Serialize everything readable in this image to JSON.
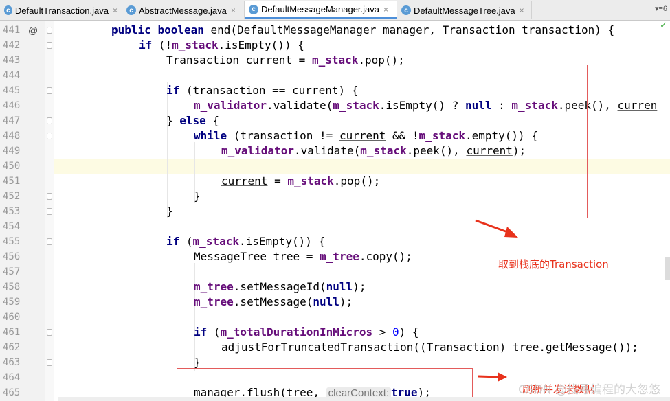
{
  "tabs": [
    {
      "label": "DefaultTransaction.java",
      "icon": "java-class-icon",
      "active": false
    },
    {
      "label": "AbstractMessage.java",
      "icon": "java-class-icon",
      "active": false
    },
    {
      "label": "DefaultMessageManager.java",
      "icon": "java-class-icon",
      "active": true
    },
    {
      "label": "DefaultMessageTree.java",
      "icon": "java-class-icon",
      "active": false
    }
  ],
  "tab_icon_letter": "c",
  "tab_close": "×",
  "tab_menu": "▾≡6",
  "gutter_marker_441": "@",
  "lines": [
    {
      "n": "441"
    },
    {
      "n": "442"
    },
    {
      "n": "443"
    },
    {
      "n": "444"
    },
    {
      "n": "445"
    },
    {
      "n": "446"
    },
    {
      "n": "447"
    },
    {
      "n": "448"
    },
    {
      "n": "449"
    },
    {
      "n": "450"
    },
    {
      "n": "451"
    },
    {
      "n": "452"
    },
    {
      "n": "453"
    },
    {
      "n": "454"
    },
    {
      "n": "455"
    },
    {
      "n": "456"
    },
    {
      "n": "457"
    },
    {
      "n": "458"
    },
    {
      "n": "459"
    },
    {
      "n": "460"
    },
    {
      "n": "461"
    },
    {
      "n": "462"
    },
    {
      "n": "463"
    },
    {
      "n": "464"
    },
    {
      "n": "465"
    }
  ],
  "code": {
    "l441": {
      "kw1": "public",
      "kw2": "boolean",
      "rest": " end(DefaultMessageManager manager, Transaction transaction) {"
    },
    "l442": {
      "kw": "if",
      "p1": " (!",
      "fld": "m_stack",
      "p2": ".isEmpty()) {"
    },
    "l443": {
      "p1": "Transaction ",
      "ul": "current",
      "p2": " = ",
      "fld": "m_stack",
      "p3": ".pop();"
    },
    "l445": {
      "kw": "if",
      "p1": " (transaction == ",
      "ul": "current",
      "p2": ") {"
    },
    "l446": {
      "fld1": "m_validator",
      "p1": ".validate(",
      "fld2": "m_stack",
      "p2": ".isEmpty() ? ",
      "kw": "null",
      "p3": " : ",
      "fld3": "m_stack",
      "p4": ".peek(), ",
      "ul": "curren"
    },
    "l447": {
      "p1": "} ",
      "kw": "else",
      "p2": " {"
    },
    "l448": {
      "kw": "while",
      "p1": " (transaction != ",
      "ul": "current",
      "p2": " && !",
      "fld": "m_stack",
      "p3": ".empty()) {"
    },
    "l449": {
      "fld1": "m_validator",
      "p1": ".validate(",
      "fld2": "m_stack",
      "p2": ".peek(), ",
      "ul": "current",
      "p3": ");"
    },
    "l451": {
      "ul": "current",
      "p1": " = ",
      "fld": "m_stack",
      "p2": ".pop();"
    },
    "l452": {
      "p1": "}"
    },
    "l453": {
      "p1": "}"
    },
    "l455": {
      "kw": "if",
      "p1": " (",
      "fld": "m_stack",
      "p2": ".isEmpty()) {"
    },
    "l456": {
      "p1": "MessageTree tree = ",
      "fld": "m_tree",
      "p2": ".copy();"
    },
    "l458": {
      "fld": "m_tree",
      "p1": ".setMessageId(",
      "kw": "null",
      "p2": ");"
    },
    "l459": {
      "fld": "m_tree",
      "p1": ".setMessage(",
      "kw": "null",
      "p2": ");"
    },
    "l461": {
      "kw": "if",
      "p1": " (",
      "fld": "m_totalDurationInMicros",
      "p2": " > ",
      "num": "0",
      "p3": ") {"
    },
    "l462": {
      "p1": "adjustForTruncatedTransaction((Transaction) tree.getMessage());"
    },
    "l463": {
      "p1": "}"
    },
    "l465": {
      "p1": "manager.flush(tree, ",
      "hint": "clearContext:",
      "kw": "true",
      "p2": ");"
    }
  },
  "annotations": {
    "bottom_stack_label": "取到栈底的Transaction",
    "flush_label": "刷新并发送数据",
    "watermark": "CSDN @找寻编程的大忽悠"
  },
  "inspection_check": "✓",
  "colors": {
    "keyword": "#000080",
    "field": "#660e7a",
    "annotation": "#e8321c",
    "tab_active_underline": "#4d8fd9"
  }
}
